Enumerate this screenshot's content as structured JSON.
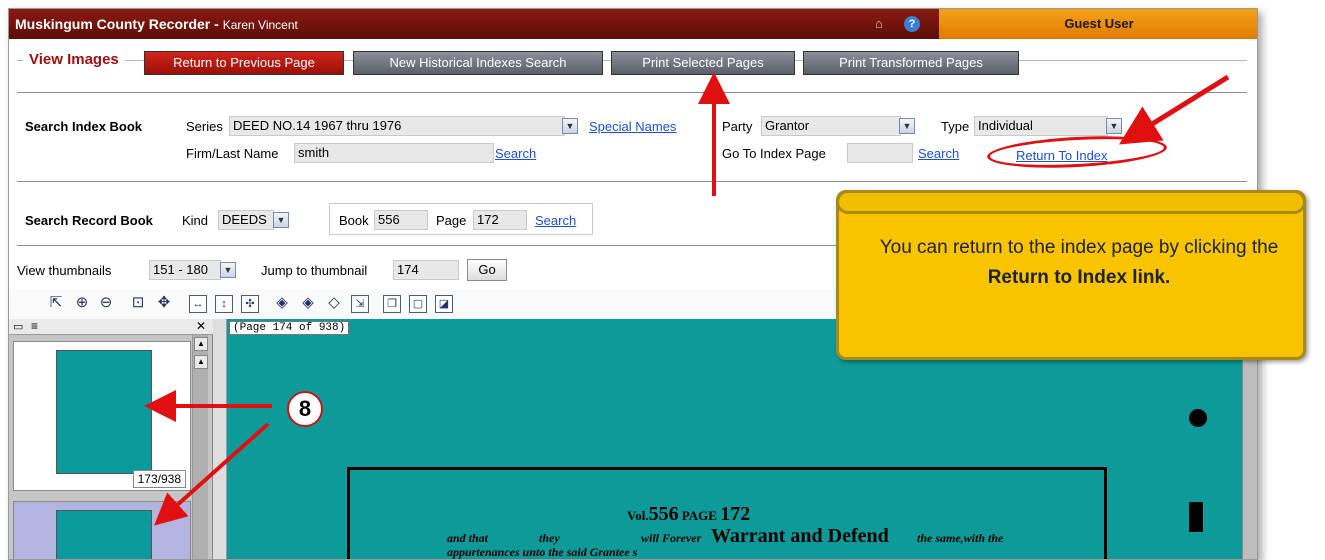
{
  "titlebar": {
    "title": "Muskingum County Recorder - ",
    "user_name": "Karen Vincent",
    "guest_label": "Guest User",
    "help_glyph": "?"
  },
  "tabs": {
    "view_images": "View Images",
    "return_prev": "Return to Previous Page",
    "new_search": "New Historical Indexes Search",
    "print_selected": "Print Selected Pages",
    "print_transformed": "Print Transformed Pages"
  },
  "index_search": {
    "heading": "Search Index Book",
    "series_label": "Series",
    "series_value": "DEED NO.14 1967 thru 1976",
    "special_names": "Special Names",
    "party_label": "Party",
    "party_value": "Grantor",
    "type_label": "Type",
    "type_value": "Individual",
    "name_label": "Firm/Last Name",
    "name_value": "smith",
    "search_link": "Search",
    "goto_label": "Go To Index Page",
    "goto_value": "",
    "return_to_index": "Return To Index"
  },
  "record_search": {
    "heading": "Search Record Book",
    "kind_label": "Kind",
    "kind_value": "DEEDS",
    "book_label": "Book",
    "book_value": "556",
    "page_label": "Page",
    "page_value": "172",
    "search_link": "Search"
  },
  "thumbnail_nav": {
    "view_label": "View thumbnails",
    "range_value": "151 - 180",
    "jump_label": "Jump to thumbnail",
    "jump_value": "174",
    "go_label": "Go"
  },
  "thumbnails": [
    {
      "caption": "173/938"
    },
    {
      "caption": ""
    }
  ],
  "viewer": {
    "page_indicator": "(Page 174 of 938)",
    "doc_number": "556",
    "doc_page": "172",
    "doc_heading": "Warrant and Defend",
    "doc_line1": "and that",
    "doc_line1b": "they",
    "doc_line1c": "will Forever",
    "doc_line1d": "the same,with the",
    "doc_line2": "appurtenances unto the said Grantee s"
  },
  "callout": {
    "text_before": "You can return to the index page by clicking the ",
    "text_bold": "Return to Index link."
  },
  "annotation": {
    "marker_number": "8"
  },
  "colors": {
    "titlebar": "#7a140e",
    "guest_bar": "#f0900c",
    "callout": "#f8c400",
    "document_bg": "#0f9a9a",
    "annotation_red": "#e01010"
  }
}
